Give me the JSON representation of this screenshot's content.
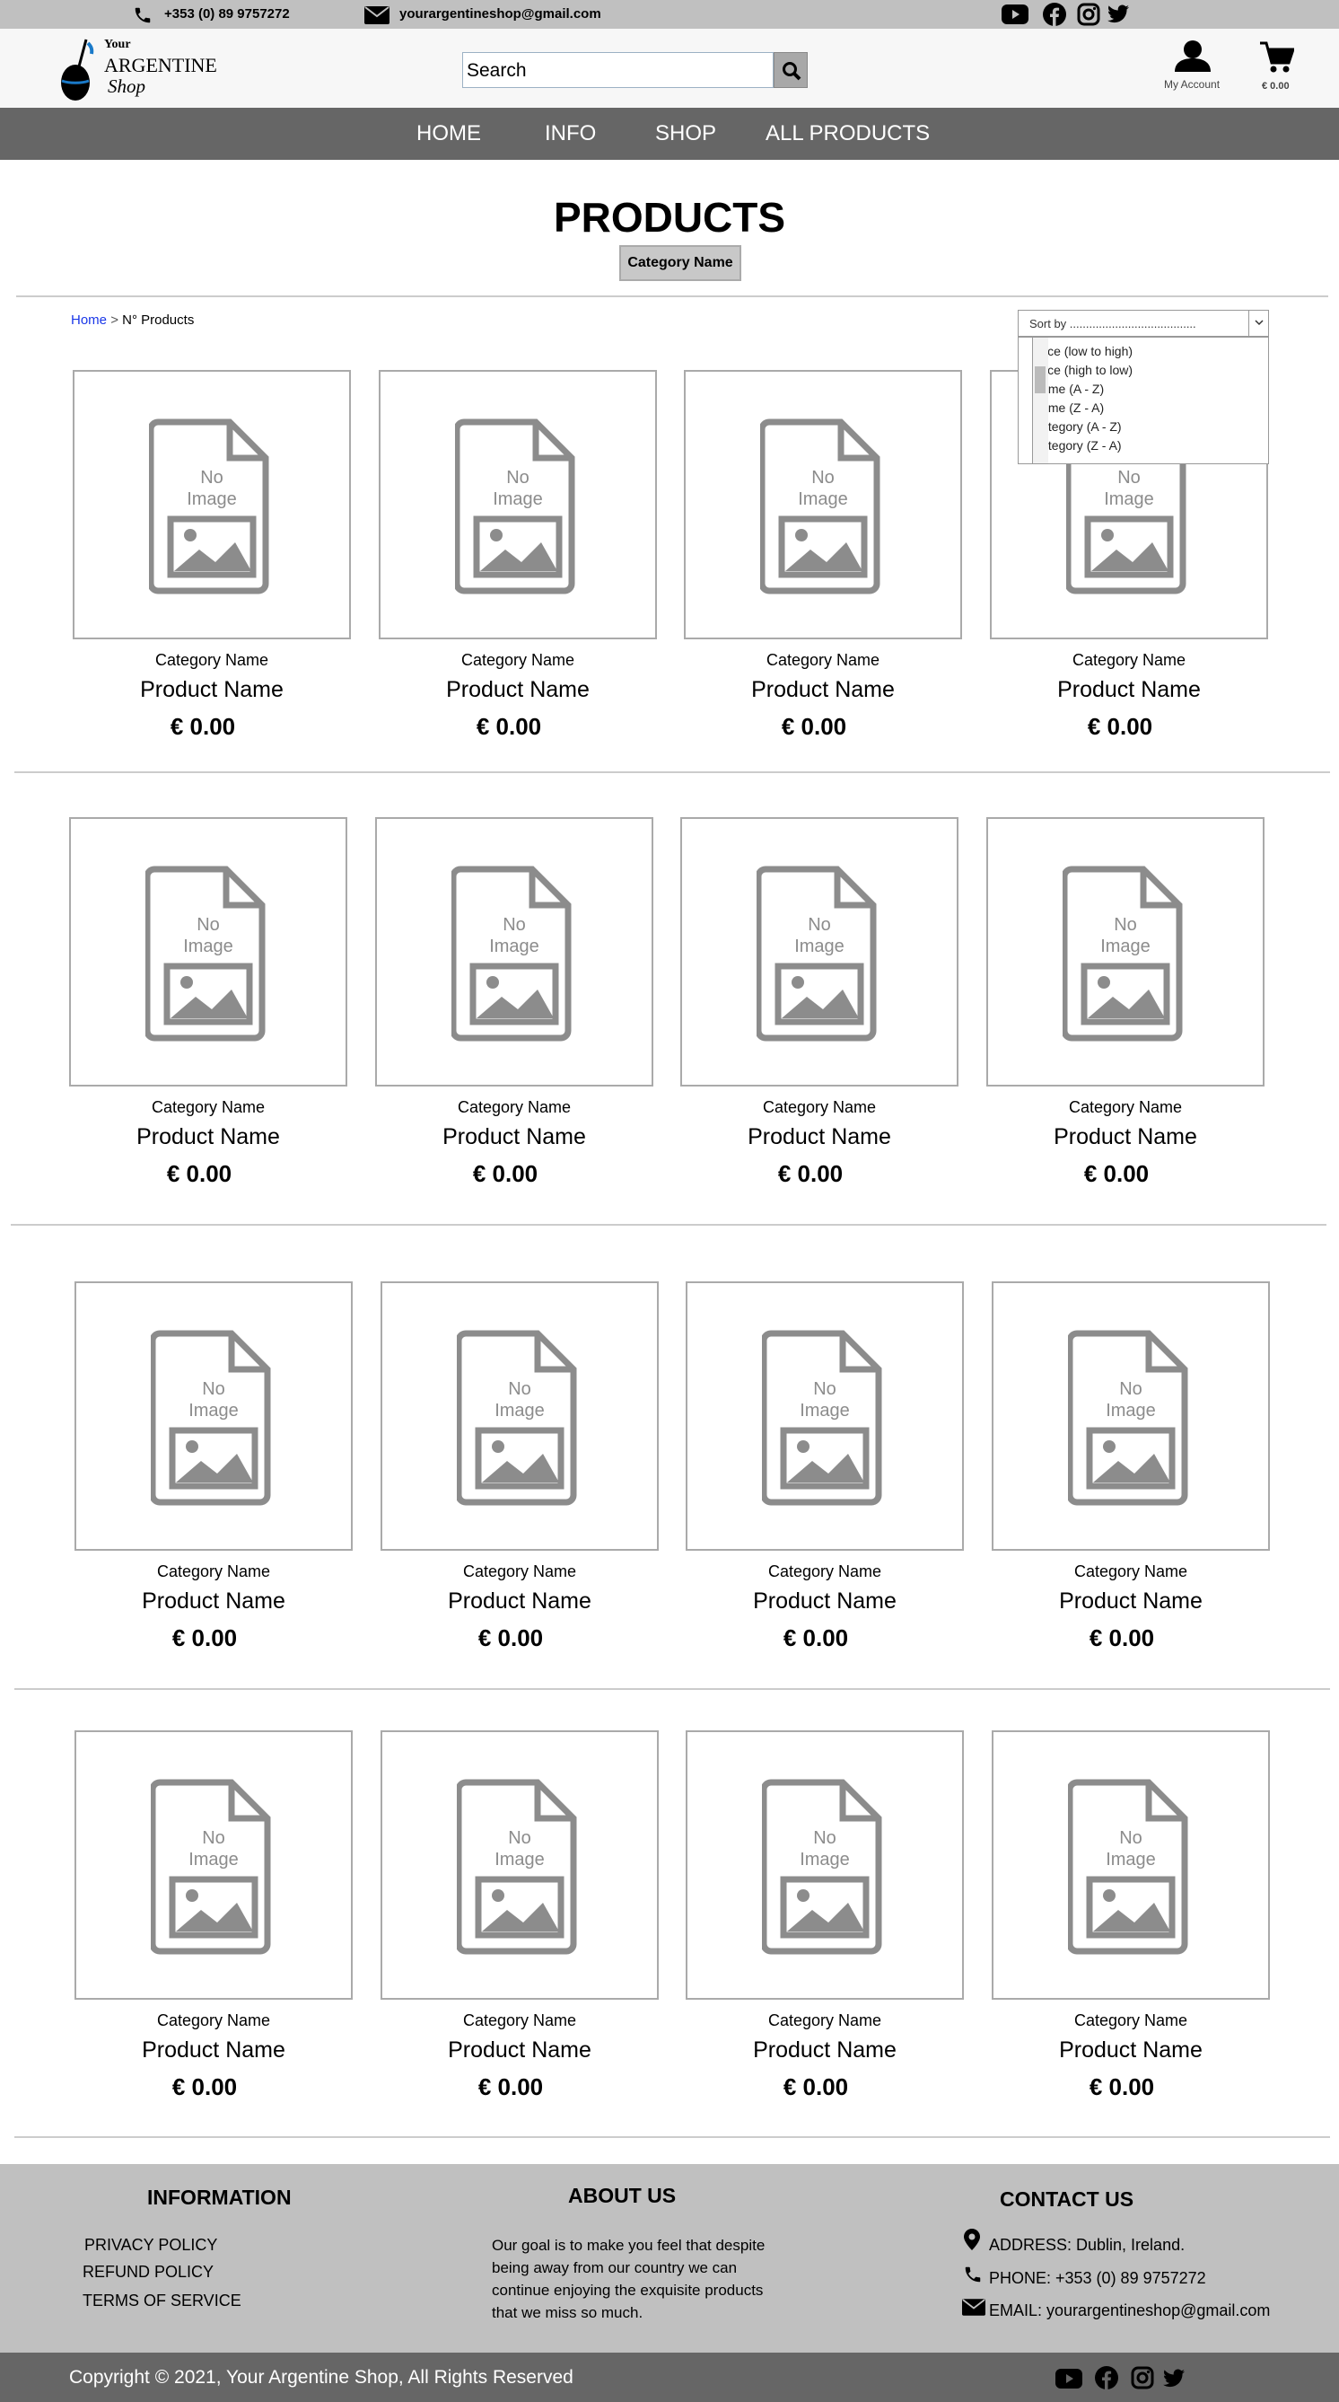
{
  "topbar": {
    "phone": "+353 (0) 89 9757272",
    "email": "yourargentineshop@gmail.com"
  },
  "header": {
    "logo": {
      "line1": "Your",
      "line2": "ARGENTINE",
      "line3": "Shop"
    },
    "search_placeholder": "Search",
    "account_label": "My Account",
    "cart_total": "€ 0.00"
  },
  "nav": [
    "HOME",
    "INFO",
    "SHOP",
    "ALL PRODUCTS"
  ],
  "page": {
    "title": "PRODUCTS",
    "category_pill": "Category Name"
  },
  "breadcrumb": {
    "home": "Home",
    "sep": ">",
    "current": "N° Products"
  },
  "sort": {
    "placeholder": "Sort by .......................................",
    "options": [
      "Price (low to high)",
      "Price (high to low)",
      "Name (A - Z)",
      "Name (Z - A)",
      "Category (A - Z)",
      "Category (Z - A)"
    ]
  },
  "product_card": {
    "no_image_1": "No",
    "no_image_2": "Image",
    "category": "Category Name",
    "name": "Product Name",
    "price": "€ 0.00"
  },
  "footer": {
    "info_title": "INFORMATION",
    "info_links": [
      "PRIVACY POLICY",
      "REFUND POLICY",
      "TERMS OF SERVICE"
    ],
    "about_title": "ABOUT US",
    "about_text": "Our goal is to make you feel that despite being away from our country we can continue enjoying the exquisite products that we miss so much.",
    "contact_title": "CONTACT US",
    "address": "ADDRESS: Dublin, Ireland.",
    "phone": "PHONE: +353 (0) 89 9757272",
    "email": "EMAIL: yourargentineshop@gmail.com",
    "copyright": "Copyright © 2021, Your Argentine Shop, All Rights Reserved"
  },
  "icons": [
    "phone-icon",
    "mail-icon",
    "youtube-icon",
    "facebook-icon",
    "instagram-icon",
    "twitter-icon",
    "search-icon",
    "account-icon",
    "cart-icon",
    "location-icon"
  ]
}
